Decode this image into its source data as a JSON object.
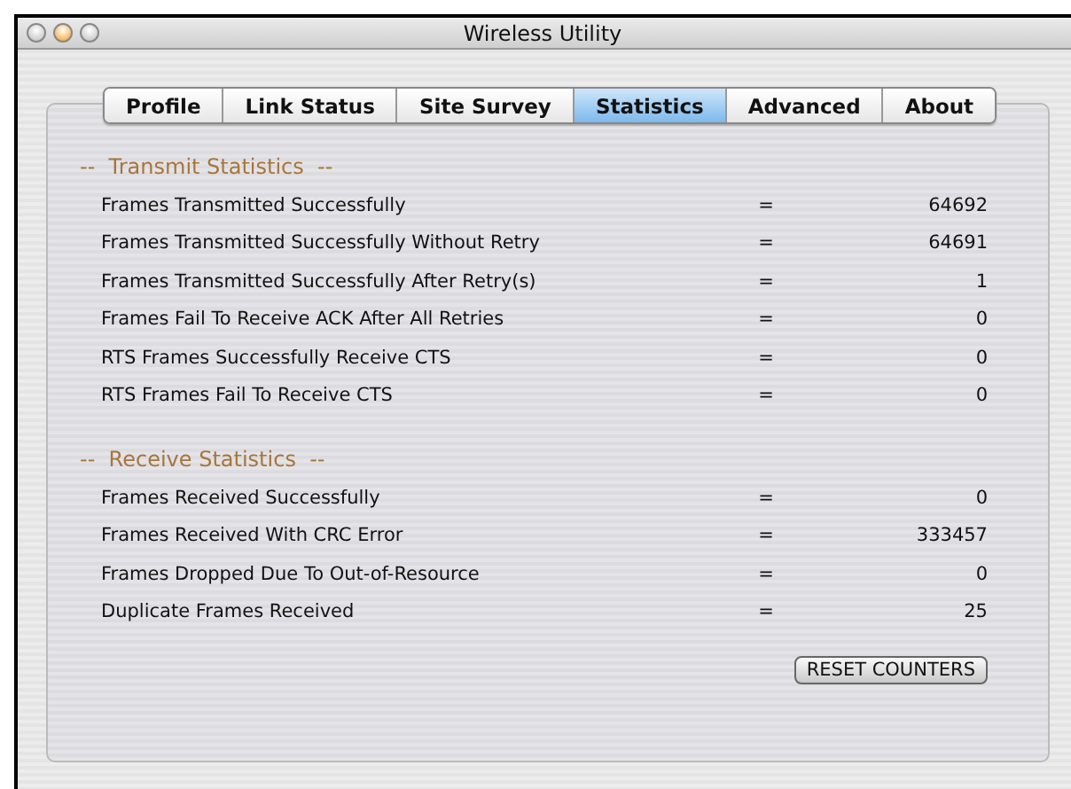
{
  "window": {
    "title": "Wireless Utility"
  },
  "tabs": [
    {
      "label": "Profile",
      "selected": false
    },
    {
      "label": "Link Status",
      "selected": false
    },
    {
      "label": "Site Survey",
      "selected": false
    },
    {
      "label": "Statistics",
      "selected": true
    },
    {
      "label": "Advanced",
      "selected": false
    },
    {
      "label": "About",
      "selected": false
    }
  ],
  "sections": [
    {
      "title": "--  Transmit Statistics  --",
      "rows": [
        {
          "label": "Frames Transmitted Successfully",
          "sign": "=",
          "value": "64692"
        },
        {
          "label": "Frames Transmitted Successfully Without Retry",
          "sign": "=",
          "value": "64691"
        },
        {
          "label": "Frames Transmitted Successfully After Retry(s)",
          "sign": "=",
          "value": "1"
        },
        {
          "label": "Frames Fail To Receive ACK After All Retries",
          "sign": "=",
          "value": "0"
        },
        {
          "label": "RTS Frames Successfully Receive CTS",
          "sign": "=",
          "value": "0"
        },
        {
          "label": "RTS Frames Fail To Receive CTS",
          "sign": "=",
          "value": "0"
        }
      ]
    },
    {
      "title": "--  Receive Statistics  --",
      "rows": [
        {
          "label": "Frames Received Successfully",
          "sign": "=",
          "value": "0"
        },
        {
          "label": "Frames Received With CRC Error",
          "sign": "=",
          "value": "333457"
        },
        {
          "label": "Frames Dropped Due To Out-of-Resource",
          "sign": "=",
          "value": "0"
        },
        {
          "label": "Duplicate Frames Received",
          "sign": "=",
          "value": "25"
        }
      ]
    }
  ],
  "reset_button": "RESET COUNTERS"
}
